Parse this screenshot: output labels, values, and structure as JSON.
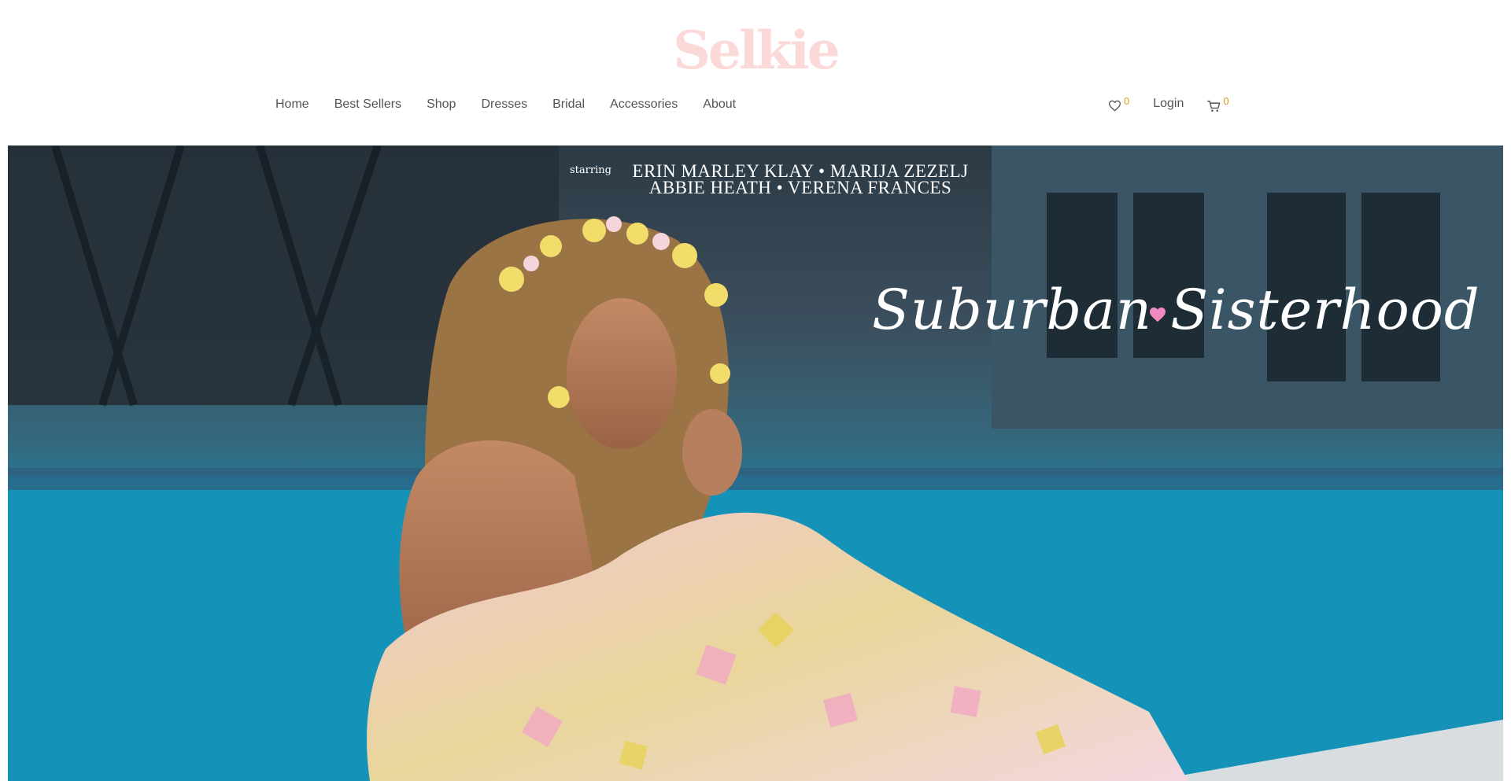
{
  "brand": {
    "logo_text": "Selkie",
    "logo_color": "#fcd9d9"
  },
  "nav": {
    "items": [
      "Home",
      "Best Sellers",
      "Shop",
      "Dresses",
      "Bridal",
      "Accessories",
      "About"
    ]
  },
  "utility": {
    "wishlist_icon": "heart-icon",
    "wishlist_count": "0",
    "login_label": "Login",
    "cart_icon": "cart-icon",
    "cart_count": "0",
    "count_color": "#d99a1a"
  },
  "hero": {
    "starring_label": "starring",
    "credits_line_1": "ERIN MARLEY KLAY • MARIJA ZEZELJ",
    "credits_line_2": "ABBIE HEATH • VERENA FRANCES",
    "campaign_title": "Suburban Sisterhood",
    "colors": {
      "pool": "#1597be",
      "text": "#ffffff",
      "heart": "#f08ac0"
    }
  }
}
